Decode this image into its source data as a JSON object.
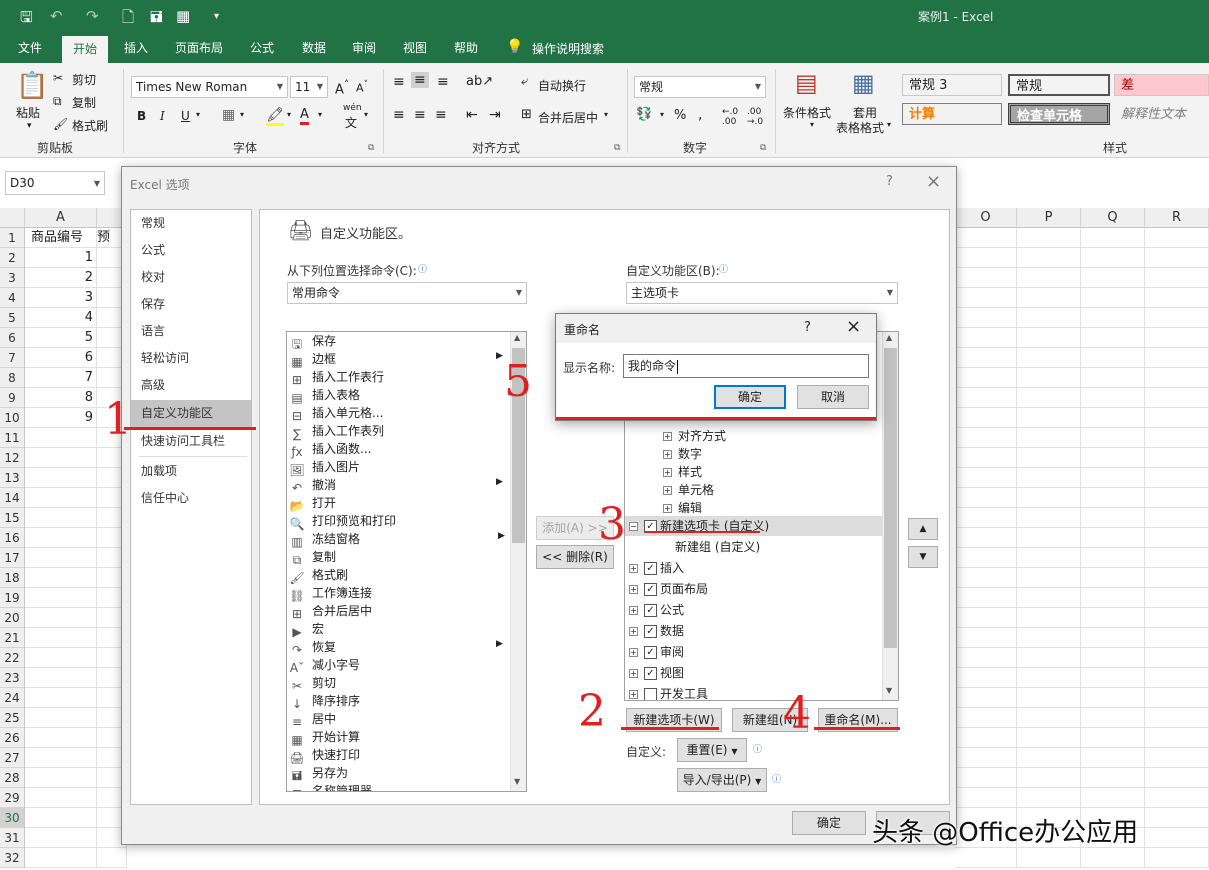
{
  "window": {
    "title": "案例1  -  Excel"
  },
  "menu": {
    "tabs": [
      "文件",
      "开始",
      "插入",
      "页面布局",
      "公式",
      "数据",
      "审阅",
      "视图",
      "帮助"
    ],
    "active": "开始",
    "tell_me": "操作说明搜索"
  },
  "ribbon": {
    "clipboard": {
      "paste": "粘贴",
      "cut": "剪切",
      "copy": "复制",
      "format_painter": "格式刷",
      "label": "剪贴板"
    },
    "font": {
      "name": "Times New Roman",
      "size": "11",
      "label": "字体",
      "wen": "wén",
      "wen_char": "文"
    },
    "alignment": {
      "wrap": "自动换行",
      "merge": "合并后居中",
      "label": "对齐方式"
    },
    "number": {
      "format": "常规",
      "label": "数字"
    },
    "styles": {
      "cond_format": "条件格式",
      "table_format_1": "套用",
      "table_format_2": "表格格式",
      "label": "样式",
      "items": [
        {
          "text": "常规 3",
          "bg": "#ffffff"
        },
        {
          "text": "常规",
          "bg": "#ffffff"
        },
        {
          "text": "差",
          "bg": "#ffc7ce"
        },
        {
          "text": "计算",
          "bg": "#f2f2f2"
        },
        {
          "text": "检查单元格",
          "bg": "#a5a5a5"
        },
        {
          "text": "解释性文本",
          "bg": "#ffffff"
        }
      ]
    }
  },
  "namebox": "D30",
  "sheet": {
    "col_a": "A",
    "col_b_cut": "预",
    "right_cols": [
      "O",
      "P",
      "Q",
      "R"
    ],
    "rows": [
      "1",
      "2",
      "3",
      "4",
      "5",
      "6",
      "7",
      "8",
      "9",
      "10",
      "11",
      "12",
      "13",
      "14",
      "15",
      "16",
      "17",
      "18",
      "19",
      "20",
      "21",
      "22",
      "23",
      "24",
      "25",
      "26",
      "27",
      "28",
      "29",
      "30",
      "31",
      "32"
    ],
    "a1": "商品编号",
    "a_values": [
      "1",
      "2",
      "3",
      "4",
      "5",
      "6",
      "7",
      "8",
      "9"
    ]
  },
  "dialog": {
    "title": "Excel 选项",
    "help": "?",
    "close": "×",
    "nav": [
      "常规",
      "公式",
      "校对",
      "保存",
      "语言",
      "轻松访问",
      "高级",
      "自定义功能区",
      "快速访问工具栏",
      "加载项",
      "信任中心"
    ],
    "heading": "自定义功能区。",
    "choose_label": "从下列位置选择命令(C):",
    "choose_value": "常用命令",
    "custom_label": "自定义功能区(B):",
    "custom_value": "主选项卡",
    "commands": [
      "保存",
      "边框",
      "插入工作表行",
      "插入表格",
      "插入单元格...",
      "插入工作表列",
      "插入函数...",
      "插入图片",
      "撤消",
      "打开",
      "打印预览和打印",
      "冻结窗格",
      "复制",
      "格式刷",
      "工作簿连接",
      "合并后居中",
      "宏",
      "恢复",
      "减小字号",
      "剪切",
      "降序排序",
      "居中",
      "开始计算",
      "快速打印",
      "另存为",
      "名称管理器"
    ],
    "add": "添加(A) >>",
    "remove": "<< 删除(R)",
    "tree_sub": [
      "对齐方式",
      "数字",
      "样式",
      "单元格",
      "编辑"
    ],
    "tree_custom_tab": "新建选项卡 (自定义)",
    "tree_custom_group": "新建组 (自定义)",
    "tree_tabs": [
      "插入",
      "页面布局",
      "公式",
      "数据",
      "审阅",
      "视图",
      "开发工具"
    ],
    "new_tab": "新建选项卡(W)",
    "new_group": "新建组(N)",
    "rename": "重命名(M)...",
    "customize_label": "自定义:",
    "reset": "重置(E)",
    "import_export": "导入/导出(P)",
    "ok": "确定",
    "up": "▲",
    "down": "▼"
  },
  "rename_dialog": {
    "title": "重命名",
    "help": "?",
    "close": "×",
    "label": "显示名称:",
    "value": "我的命令",
    "ok": "确定",
    "cancel": "取消"
  },
  "annotations": [
    "1",
    "2",
    "3",
    "4",
    "5"
  ],
  "watermark": "头条 @Office办公应用"
}
